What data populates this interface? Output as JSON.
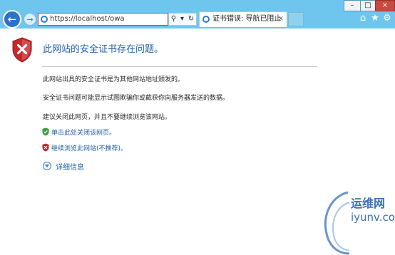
{
  "browser": {
    "address": "https://localhost/owa",
    "tab_title": "证书错误: 导航已阻止",
    "tab_close": "×",
    "search_glyph": "⚲",
    "dropdown_glyph": "▾",
    "refresh_glyph": "↻",
    "back_glyph": "←",
    "forward_glyph": "→",
    "home_glyph": "⌂",
    "favorites_glyph": "★",
    "settings_glyph": "⚙",
    "window_controls": {
      "minimize": "–",
      "maximize": "□",
      "close": "×"
    }
  },
  "page": {
    "title": "此网站的安全证书存在问题。",
    "paragraph1": "此网站出具的安全证书是为其他网站地址颁发的。",
    "paragraph2": "安全证书问题可能显示试图欺骗你或截获你向服务器发送的数据。",
    "paragraph3": "建议关闭此网页，并且不要继续浏览该网站。",
    "close_link": "单击此处关闭该网页。",
    "continue_link": "继续浏览此网站(不推荐)。",
    "more_info": "详细信息"
  },
  "watermark": {
    "line1": "运维网",
    "line2": "iyunv.com"
  },
  "colors": {
    "chrome": "#6ec6ee",
    "link": "#1f5fa6",
    "shield_red": "#c8262b",
    "shield_green": "#3a9b3a"
  }
}
